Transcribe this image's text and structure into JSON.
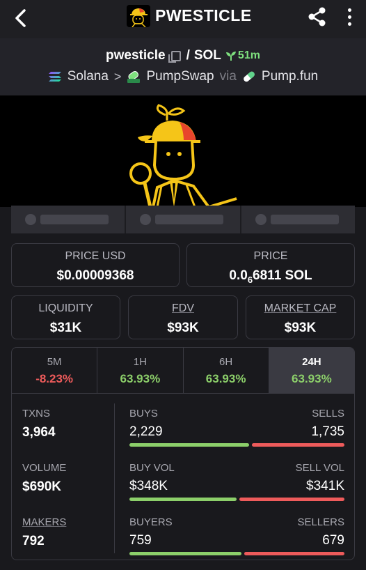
{
  "header": {
    "title": "PWESTICLE"
  },
  "pair": {
    "base": "pwesticle",
    "separator": "/",
    "quote": "SOL",
    "age": "51m",
    "chain": "Solana",
    "dex": "PumpSwap",
    "via_text": "via",
    "launchpad": "Pump.fun"
  },
  "prices": {
    "usd_label": "PRICE USD",
    "usd_value": "$0.00009368",
    "native_label": "PRICE",
    "native_prefix": "0.0",
    "native_zeros": "6",
    "native_rest": "6811 SOL"
  },
  "metrics": {
    "liquidity_label": "LIQUIDITY",
    "liquidity_value": "$31K",
    "fdv_label": "FDV",
    "fdv_value": "$93K",
    "mcap_label": "MARKET CAP",
    "mcap_value": "$93K"
  },
  "timeframes": [
    {
      "label": "5M",
      "change": "-8.23%"
    },
    {
      "label": "1H",
      "change": "63.93%"
    },
    {
      "label": "6H",
      "change": "63.93%"
    },
    {
      "label": "24H",
      "change": "63.93%"
    }
  ],
  "active_timeframe": "24H",
  "stats": {
    "txns_label": "TXNS",
    "txns_value": "3,964",
    "volume_label": "VOLUME",
    "volume_value": "$690K",
    "makers_label": "MAKERS",
    "makers_value": "792",
    "buys_label": "BUYS",
    "buys_value": "2,229",
    "sells_label": "SELLS",
    "sells_value": "1,735",
    "buy_vol_label": "BUY VOL",
    "buy_vol_value": "$348K",
    "sell_vol_label": "SELL VOL",
    "sell_vol_value": "$341K",
    "buyers_label": "BUYERS",
    "buyers_value": "759",
    "sellers_label": "SELLERS",
    "sellers_value": "679",
    "buys_fraction": 0.562,
    "buy_vol_fraction": 0.505,
    "buyers_fraction": 0.528
  },
  "colors": {
    "positive": "#8ccf6a",
    "negative": "#ee5b5b",
    "background": "#19191d"
  },
  "icons": [
    "back-arrow-icon",
    "share-icon",
    "more-vertical-icon",
    "copy-icon",
    "seedling-icon",
    "solana-icon",
    "pumpswap-icon",
    "pill-icon"
  ]
}
